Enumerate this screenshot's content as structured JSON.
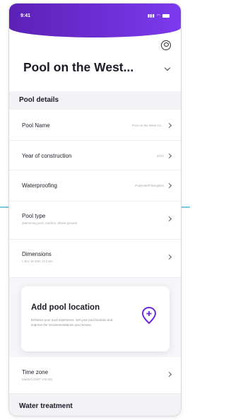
{
  "status_bar": {
    "time": "9:41",
    "signal_icon": "signal-icon",
    "wifi_icon": "wifi-icon",
    "battery_icon": "battery-icon"
  },
  "header": {
    "title": "Pool on the West...",
    "profile_icon": "profile-icon",
    "dropdown_icon": "chevron-down-icon"
  },
  "colors": {
    "accent": "#6d28d9",
    "accent_light": "#7c3aed",
    "divider": "#7fc6e6"
  },
  "sections": {
    "pool_details": "Pool details",
    "water_treatment": "Water treatment"
  },
  "rows": [
    {
      "label": "Pool Name",
      "value": "Pool on the West Co..."
    },
    {
      "label": "Year of construction",
      "value": "2012"
    },
    {
      "label": "Waterproofing",
      "value": "Polyester/Fiberglass"
    },
    {
      "label": "Pool type",
      "sub": "Swimming pool, outdoor, above ground"
    },
    {
      "label": "Dimensions",
      "sub": "L:5m, W:10m, H:2.5m"
    }
  ],
  "location_card": {
    "title": "Add pool location",
    "description": "Enhance your pool experience. Set your pool location and improve the recommendations you receive.",
    "icon": "location-add-icon"
  },
  "timezone": {
    "label": "Time zone",
    "sub": "Madrid (GMT +02:00)"
  }
}
